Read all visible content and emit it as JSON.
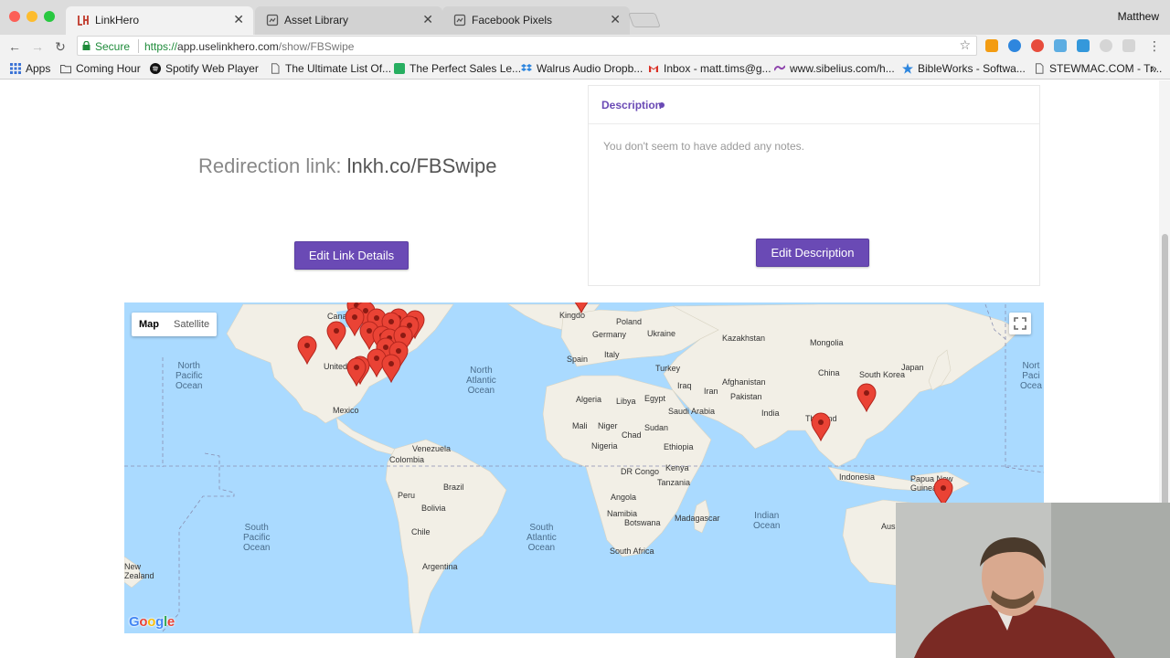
{
  "browser": {
    "tabs": [
      {
        "title": "LinkHero",
        "active": true
      },
      {
        "title": "Asset Library",
        "active": false
      },
      {
        "title": "Facebook Pixels",
        "active": false
      }
    ],
    "tab_close": "✕",
    "profile_name": "Matthew",
    "secure_label": "Secure",
    "url_scheme": "https://",
    "url_host": "app.uselinkhero.com",
    "url_path": "/show/FBSwipe",
    "bookmarks": [
      "Apps",
      "Coming Hour",
      "Spotify Web Player",
      "The Ultimate List Of...",
      "The Perfect Sales Le...",
      "Walrus Audio Dropb...",
      "Inbox - matt.tims@g...",
      "www.sibelius.com/h...",
      "BibleWorks - Softwa...",
      "STEWMAC.COM - Tr..."
    ],
    "overflow": "»"
  },
  "page": {
    "redirect_label": "Redirection link:",
    "redirect_link": "lnkh.co/FBSwipe",
    "edit_link_button": "Edit Link Details",
    "description_title": "Description",
    "description_empty": "You don't seem to have added any notes.",
    "edit_description_button": "Edit Description"
  },
  "map": {
    "type_options": [
      "Map",
      "Satellite"
    ],
    "selected_type": "Map",
    "oceans": {
      "north_pacific_left": "North\nPacific\nOcean",
      "north_atlantic": "North\nAtlantic\nOcean",
      "south_pacific": "South\nPacific\nOcean",
      "south_atlantic": "South\nAtlantic\nOcean",
      "indian": "Indian\nOcean",
      "north_pacific_right": "Nort\nPaci\nOcea"
    },
    "labels": {
      "canada": "Cana",
      "united": "United",
      "mexico": "Mexico",
      "venezuela": "Venezuela",
      "colombia": "Colombia",
      "peru": "Peru",
      "brazil": "Brazil",
      "bolivia": "Bolivia",
      "chile": "Chile",
      "argentina": "Argentina",
      "new_zealand": "New\nZealand",
      "kingdom": "Kingdo",
      "poland": "Poland",
      "germany": "Germany",
      "ukraine": "Ukraine",
      "italy": "Italy",
      "spain": "Spain",
      "turkey": "Turkey",
      "algeria": "Algeria",
      "libya": "Libya",
      "egypt": "Egypt",
      "mali": "Mali",
      "niger": "Niger",
      "chad": "Chad",
      "sudan": "Sudan",
      "nigeria": "Nigeria",
      "ethiopia": "Ethiopia",
      "dr_congo": "DR Congo",
      "kenya": "Kenya",
      "tanzania": "Tanzania",
      "angola": "Angola",
      "namibia": "Namibia",
      "botswana": "Botswana",
      "south_africa": "South Africa",
      "madagascar": "Madagascar",
      "iraq": "Iraq",
      "iran": "Iran",
      "saudi_arabia": "Saudi Arabia",
      "afghanistan": "Afghanistan",
      "pakistan": "Pakistan",
      "india": "India",
      "kazakhstan": "Kazakhstan",
      "mongolia": "Mongolia",
      "china": "China",
      "south_korea": "South Korea",
      "japan": "Japan",
      "thailand": "Thailand",
      "indonesia": "Indonesia",
      "papua_new_guinea": "Papua New\nGuinea",
      "aus": "Aus"
    },
    "google_logo": "Google"
  }
}
